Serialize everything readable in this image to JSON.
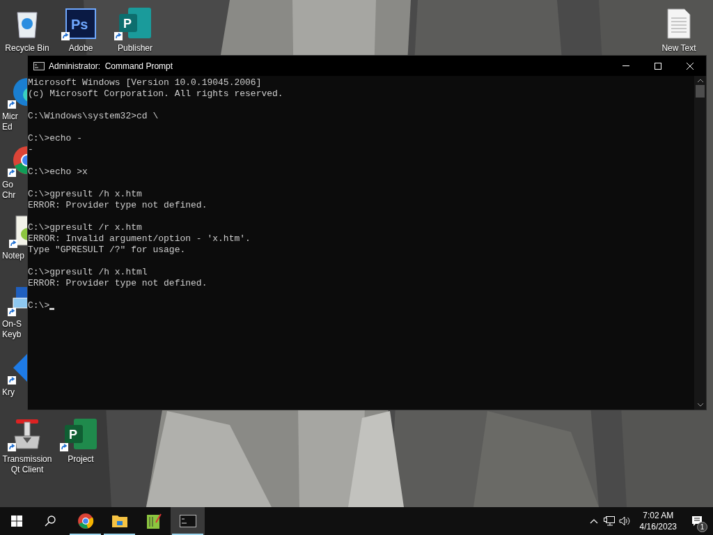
{
  "desktop_icons": [
    {
      "kind": "recycle-bin",
      "label_lines": [
        "Recycle Bin"
      ],
      "shortcut": false
    },
    {
      "kind": "photoshop",
      "glyph": "Ps",
      "label_lines": [
        "Adobe"
      ],
      "shortcut": true
    },
    {
      "kind": "publisher",
      "glyph": "P",
      "label_lines": [
        "Publisher"
      ],
      "shortcut": true
    },
    {
      "kind": "text-file",
      "label_lines": [
        "New Text"
      ],
      "shortcut": false
    },
    {
      "kind": "edge",
      "label_lines": [
        "Micr",
        "Ed"
      ],
      "shortcut": true
    },
    {
      "kind": "chrome",
      "label_lines": [
        "Go",
        "Chr"
      ],
      "shortcut": true
    },
    {
      "kind": "notepad",
      "label_lines": [
        "Notep"
      ],
      "shortcut": true
    },
    {
      "kind": "keyboard",
      "label_lines": [
        "On-S",
        "Keyb"
      ],
      "shortcut": true
    },
    {
      "kind": "diamond",
      "label_lines": [
        "Kry"
      ],
      "shortcut": true
    },
    {
      "kind": "transmission",
      "label_lines": [
        "Transmission",
        "Qt Client"
      ],
      "shortcut": true
    },
    {
      "kind": "project",
      "glyph": "P",
      "label_lines": [
        "Project"
      ],
      "shortcut": true
    }
  ],
  "window": {
    "title": "Administrator:  Command Prompt",
    "console_blocks": [
      [
        "Microsoft Windows [Version 10.0.19045.2006]",
        "(c) Microsoft Corporation. All rights reserved."
      ],
      [
        "C:\\Windows\\system32>cd \\"
      ],
      [
        "C:\\>echo -",
        "-"
      ],
      [
        "C:\\>echo >x"
      ],
      [
        "C:\\>gpresult /h x.htm",
        "ERROR: Provider type not defined."
      ],
      [
        "C:\\>gpresult /r x.htm",
        "ERROR: Invalid argument/option - 'x.htm'.",
        "Type \"GPRESULT /?\" for usage."
      ],
      [
        "C:\\>gpresult /h x.html",
        "ERROR: Provider type not defined."
      ],
      [
        "C:\\>"
      ]
    ]
  },
  "taskbar": {
    "apps": [
      {
        "kind": "chrome",
        "running": true,
        "selected": false
      },
      {
        "kind": "explorer",
        "running": true,
        "selected": false
      },
      {
        "kind": "notepad",
        "running": false,
        "selected": false
      },
      {
        "kind": "console",
        "running": true,
        "selected": true
      }
    ],
    "time": "7:02 AM",
    "date": "4/16/2023",
    "notification_count": "1"
  }
}
